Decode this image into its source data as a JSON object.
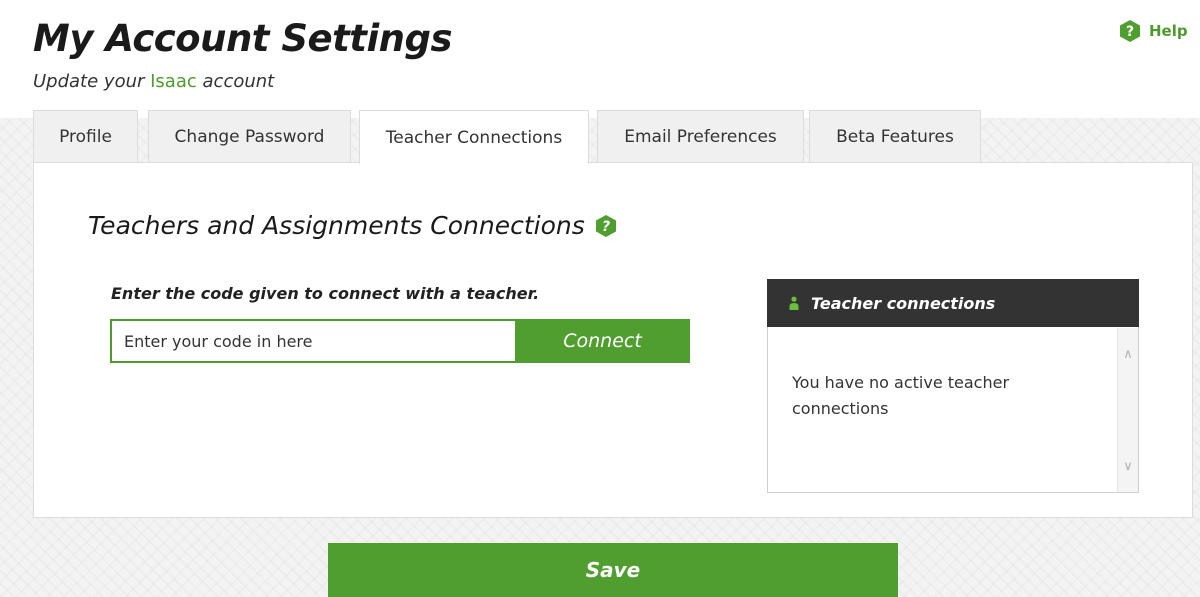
{
  "header": {
    "title": "My Account Settings",
    "subtitle_prefix": "Update your",
    "subtitle_brand": "Isaac",
    "subtitle_suffix": "account",
    "help_label": "Help"
  },
  "tabs": [
    {
      "label": "Profile",
      "active": false
    },
    {
      "label": "Change Password",
      "active": false
    },
    {
      "label": "Teacher Connections",
      "active": true
    },
    {
      "label": "Email Preferences",
      "active": false
    },
    {
      "label": "Beta Features",
      "active": false
    }
  ],
  "teacher_connections": {
    "section_title": "Teachers and Assignments Connections",
    "prompt": "Enter the code given to connect with a teacher.",
    "code_input": {
      "value": "",
      "placeholder": "Enter your code in here"
    },
    "connect_label": "Connect",
    "panel": {
      "title": "Teacher connections",
      "empty_message": "You have no active teacher connections"
    }
  },
  "save_label": "Save",
  "colors": {
    "brand_green": "#509e2f",
    "panel_header": "#333333"
  },
  "icons": {
    "help": "question-hexagon-icon",
    "user": "user-icon"
  }
}
